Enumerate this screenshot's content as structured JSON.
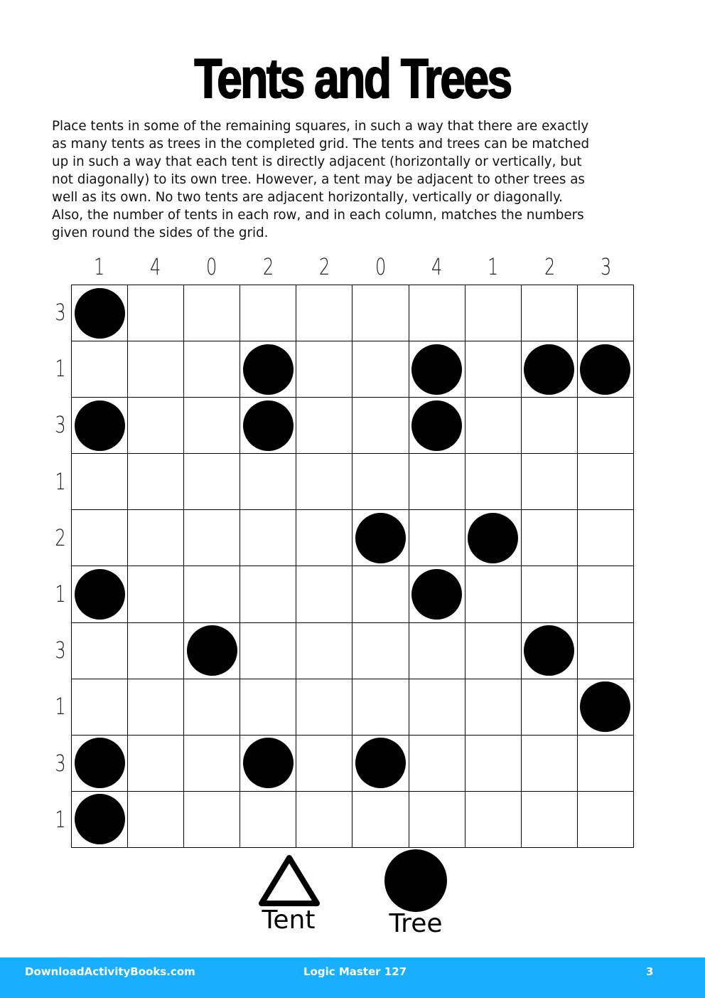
{
  "title": "Tents and Trees",
  "instructions": "Place tents in some of the remaining squares, in such a way that there are exactly\nas many tents as trees in the completed grid. The tents and trees can be matched\nup in such a way that each tent is directly adjacent (horizontally or vertically, but\nnot diagonally) to its own tree. However, a tent may be adjacent to other trees as\nwell as its own. No two tents are adjacent horizontally, vertically or diagonally.\nAlso, the number of tents in each row, and in each column, matches the numbers\ngiven round the sides of the grid.",
  "puzzle": {
    "rows": 10,
    "cols": 10,
    "column_clues": [
      "1",
      "4",
      "0",
      "2",
      "2",
      "0",
      "4",
      "1",
      "2",
      "3"
    ],
    "row_clues": [
      "3",
      "1",
      "3",
      "1",
      "2",
      "1",
      "3",
      "1",
      "3",
      "1"
    ],
    "trees": [
      [
        0,
        0
      ],
      [
        1,
        3
      ],
      [
        1,
        6
      ],
      [
        1,
        8
      ],
      [
        1,
        9
      ],
      [
        2,
        0
      ],
      [
        2,
        3
      ],
      [
        2,
        6
      ],
      [
        4,
        5
      ],
      [
        4,
        7
      ],
      [
        5,
        0
      ],
      [
        5,
        6
      ],
      [
        6,
        2
      ],
      [
        6,
        8
      ],
      [
        7,
        9
      ],
      [
        8,
        0
      ],
      [
        8,
        3
      ],
      [
        8,
        5
      ],
      [
        9,
        0
      ]
    ]
  },
  "legend": {
    "tent_label": "Tent",
    "tree_label": "Tree",
    "tent_icon": "triangle-outline-icon",
    "tree_icon": "filled-circle-icon"
  },
  "footer": {
    "site": "DownloadActivityBooks.com",
    "book": "Logic Master 127",
    "page": "3",
    "background_color": "#1aaeff"
  }
}
